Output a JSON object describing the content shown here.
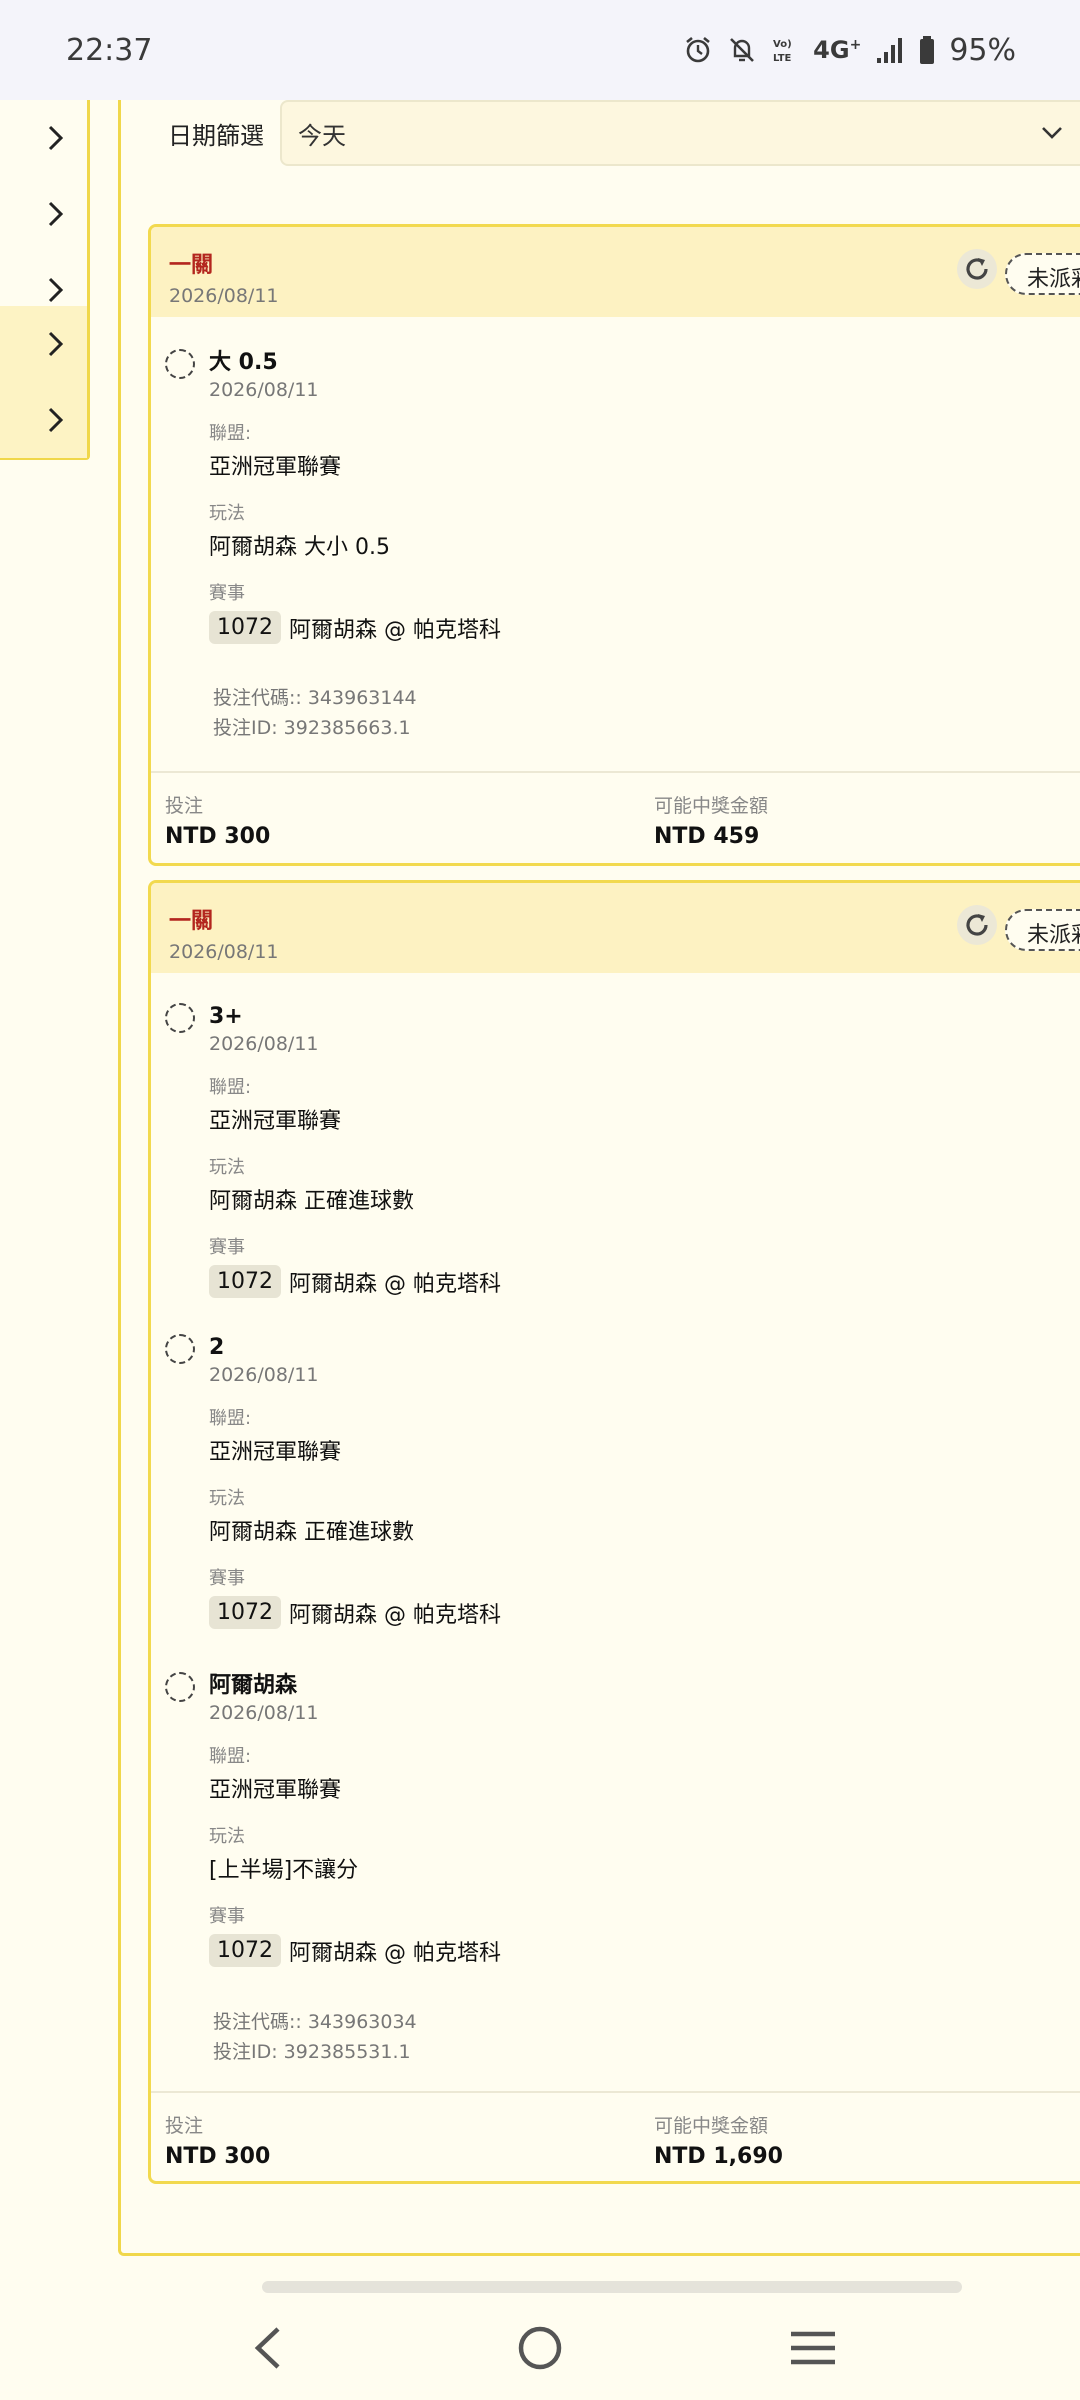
{
  "status_bar": {
    "time": "22:37",
    "network": "4G",
    "battery": "95%",
    "icons": [
      "alarm-icon",
      "mute-notifications-icon",
      "volte-icon",
      "network-4g-icon",
      "signal-icon",
      "battery-icon"
    ]
  },
  "filter": {
    "label": "日期篩選",
    "value": "今天"
  },
  "bets": [
    {
      "type": "一關",
      "date": "2026/08/11",
      "status": "未派彩",
      "legs": [
        {
          "selection": "大 0.5",
          "date": "2026/08/11",
          "league_label": "聯盟:",
          "league": "亞洲冠軍聯賽",
          "market_label": "玩法",
          "market": "阿爾胡森 大小 0.5",
          "event_label": "賽事",
          "event_id": "1072",
          "event_name": "阿爾胡森 @ 帕克塔科"
        }
      ],
      "code_line": "投注代碼:: 343963144",
      "id_line": "投注ID: 392385663.1",
      "stake_label": "投注",
      "stake": "NTD 300",
      "payout_label": "可能中獎金額",
      "payout": "NTD 459"
    },
    {
      "type": "一關",
      "date": "2026/08/11",
      "status": "未派彩",
      "legs": [
        {
          "selection": "3+",
          "date": "2026/08/11",
          "league_label": "聯盟:",
          "league": "亞洲冠軍聯賽",
          "market_label": "玩法",
          "market": "阿爾胡森 正確進球數",
          "event_label": "賽事",
          "event_id": "1072",
          "event_name": "阿爾胡森 @ 帕克塔科"
        },
        {
          "selection": "2",
          "date": "2026/08/11",
          "league_label": "聯盟:",
          "league": "亞洲冠軍聯賽",
          "market_label": "玩法",
          "market": "阿爾胡森 正確進球數",
          "event_label": "賽事",
          "event_id": "1072",
          "event_name": "阿爾胡森 @ 帕克塔科"
        },
        {
          "selection": "阿爾胡森",
          "date": "2026/08/11",
          "league_label": "聯盟:",
          "league": "亞洲冠軍聯賽",
          "market_label": "玩法",
          "market": "[上半場]不讓分",
          "event_label": "賽事",
          "event_id": "1072",
          "event_name": "阿爾胡森 @ 帕克塔科"
        }
      ],
      "code_line": "投注代碼:: 343963034",
      "id_line": "投注ID: 392385531.1",
      "stake_label": "投注",
      "stake": "NTD 300",
      "payout_label": "可能中獎金額",
      "payout": "NTD 1,690"
    }
  ],
  "colors": {
    "accent_border": "#f2d94e",
    "header_bg": "#fdf2c2",
    "bet_type": "#b3261e",
    "page_bg": "#fffdf0"
  }
}
